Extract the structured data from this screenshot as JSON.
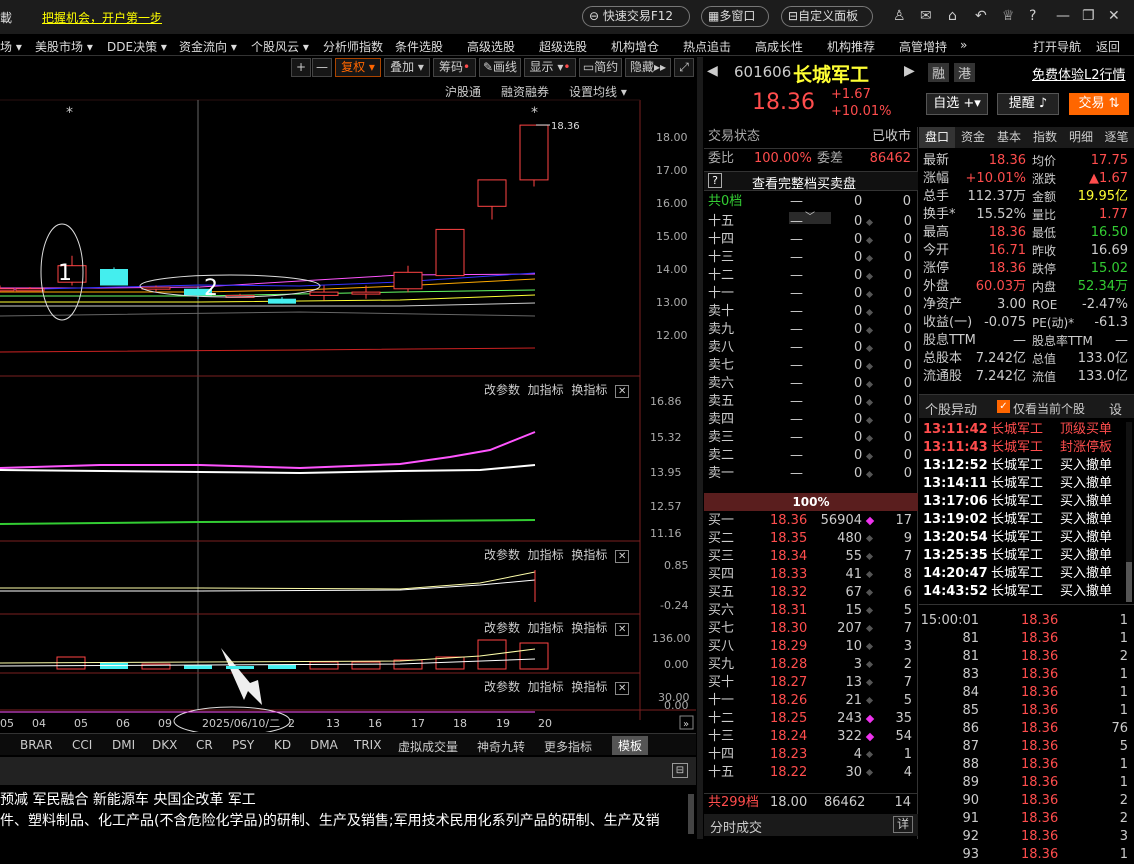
{
  "topbar": {
    "left_partial": "載",
    "slogan": "把握机会，开户第一步",
    "quick_trade": "快速交易F12",
    "multi_window": "多窗口",
    "custom_panel": "自定义面板"
  },
  "menu": [
    "场 ▾",
    "美股市场 ▾",
    "DDE决策 ▾",
    "资金流向 ▾",
    "个股风云 ▾",
    "分析师指数",
    "条件选股",
    "高级选股",
    "超级选股",
    "机构增仓",
    "热点追击",
    "高成长性",
    "机构推荐",
    "高管增持",
    "»",
    "打开导航",
    "返回"
  ],
  "toolbar": {
    "plus": "+",
    "minus": "—",
    "fuquan": "复权",
    "diejia": "叠加",
    "chouma": "筹码",
    "huaxian": "画线",
    "xianshi": "显示",
    "jianyue": "简约",
    "yincang": "隐藏"
  },
  "chart_header": {
    "hgt": "沪股通",
    "rzrq": "融资融券",
    "setma": "设置均线"
  },
  "main_chart": {
    "last_label": "18.36",
    "y_ticks": [
      "18.00",
      "17.00",
      "16.00",
      "15.00",
      "14.00",
      "13.00",
      "12.00"
    ],
    "marker1": "1",
    "marker2": "2",
    "star": "*"
  },
  "panel_ctrl": {
    "modify": "改参数",
    "add": "加指标",
    "change": "换指标",
    "close": "✕"
  },
  "ind1": {
    "ticks": [
      "16.86",
      "15.32",
      "13.95",
      "12.57",
      "11.16"
    ]
  },
  "ind2": {
    "ticks": [
      "0.85",
      "-0.24"
    ]
  },
  "ind3": {
    "ticks": [
      "136.00",
      "0.00"
    ]
  },
  "ind4": {
    "ticks": [
      "30.00",
      "0.00"
    ]
  },
  "xaxis": {
    "labels": [
      "05",
      "04",
      "05",
      "06",
      "09",
      "2025/06/10/二",
      "2",
      "13",
      "16",
      "17",
      "18",
      "19",
      "20"
    ]
  },
  "ind_tabs": [
    "BRAR",
    "CCI",
    "DMI",
    "DKX",
    "CR",
    "PSY",
    "KD",
    "DMA",
    "TRIX",
    "虚拟成交量",
    "神奇九转",
    "更多指标",
    "模板"
  ],
  "news": {
    "line1": "预减  军民融合  新能源车  央国企改革  军工",
    "line2": "件、塑料制品、化工产品(不含危险化学品)的研制、生产及销售;军用技术民用化系列产品的研制、生产及销"
  },
  "stock": {
    "code": "601606",
    "name": "长城军工",
    "price": "18.36",
    "change": "+1.67",
    "pct": "+10.01%",
    "btn_rong": "融",
    "btn_gang": "港",
    "l2": "免费体验L2行情",
    "zixuan": "自选",
    "tixing": "提醒",
    "jiaoyi": "交易"
  },
  "orderbook": {
    "status_label": "交易状态",
    "status": "已收市",
    "weibi_label": "委比",
    "weibi": "100.00%",
    "weicha_label": "委差",
    "weicha": "86462",
    "full": "查看完整档买卖盘",
    "gong0": "共0档",
    "dash": "—",
    "zero": "0",
    "sell": [
      "十五",
      "十四",
      "十三",
      "十二",
      "十一",
      "卖十",
      "卖九",
      "卖八",
      "卖七",
      "卖六",
      "卖五",
      "卖四",
      "卖三",
      "卖二",
      "卖一"
    ],
    "pct": "100%",
    "buy": [
      [
        "买一",
        "18.36",
        "56904",
        "17"
      ],
      [
        "买二",
        "18.35",
        "480",
        "9"
      ],
      [
        "买三",
        "18.34",
        "55",
        "7"
      ],
      [
        "买四",
        "18.33",
        "41",
        "8"
      ],
      [
        "买五",
        "18.32",
        "67",
        "6"
      ],
      [
        "买六",
        "18.31",
        "15",
        "5"
      ],
      [
        "买七",
        "18.30",
        "207",
        "7"
      ],
      [
        "买八",
        "18.29",
        "10",
        "3"
      ],
      [
        "买九",
        "18.28",
        "3",
        "2"
      ],
      [
        "买十",
        "18.27",
        "13",
        "7"
      ],
      [
        "十一",
        "18.26",
        "21",
        "5"
      ],
      [
        "十二",
        "18.25",
        "243",
        "35"
      ],
      [
        "十三",
        "18.24",
        "322",
        "54"
      ],
      [
        "十四",
        "18.23",
        "4",
        "1"
      ],
      [
        "十五",
        "18.22",
        "30",
        "4"
      ]
    ],
    "gong299": "共299档",
    "g_price": "18.00",
    "g_vol": "86462",
    "g_cnt": "14",
    "fenshi": "分时成交",
    "xiang": "详"
  },
  "tabs": [
    "盘口",
    "资金",
    "基本",
    "指数",
    "明细",
    "逐笔"
  ],
  "quote": [
    [
      "最新",
      "18.36",
      "均价",
      "17.75"
    ],
    [
      "涨幅",
      "+10.01%",
      "涨跌",
      "▲1.67"
    ],
    [
      "总手",
      "112.37万",
      "金额",
      "19.95亿"
    ],
    [
      "换手*",
      "15.52%",
      "量比",
      "1.77"
    ],
    [
      "最高",
      "18.36",
      "最低",
      "16.50"
    ],
    [
      "今开",
      "16.71",
      "昨收",
      "16.69"
    ],
    [
      "涨停",
      "18.36",
      "跌停",
      "15.02"
    ],
    [
      "外盘",
      "60.03万",
      "内盘",
      "52.34万"
    ],
    [
      "净资产",
      "3.00",
      "ROE",
      "-2.47%"
    ],
    [
      "收益(一)",
      "-0.075",
      "PE(动)*",
      "-61.3"
    ],
    [
      "股息TTM",
      "—",
      "股息率TTM",
      "—"
    ],
    [
      "总股本",
      "7.242亿",
      "总值",
      "133.0亿"
    ],
    [
      "流通股",
      "7.242亿",
      "流值",
      "133.0亿"
    ]
  ],
  "anomaly": {
    "title": "个股异动",
    "check": "仅看当前个股",
    "set": "设",
    "rows": [
      [
        "13:11:42",
        "长城军工",
        "顶级买单"
      ],
      [
        "13:11:43",
        "长城军工",
        "封涨停板"
      ],
      [
        "13:12:52",
        "长城军工",
        "买入撤单"
      ],
      [
        "13:14:11",
        "长城军工",
        "买入撤单"
      ],
      [
        "13:17:06",
        "长城军工",
        "买入撤单"
      ],
      [
        "13:19:02",
        "长城军工",
        "买入撤单"
      ],
      [
        "13:20:54",
        "长城军工",
        "买入撤单"
      ],
      [
        "13:25:35",
        "长城军工",
        "买入撤单"
      ],
      [
        "14:20:47",
        "长城军工",
        "买入撤单"
      ],
      [
        "14:43:52",
        "长城军工",
        "买入撤单"
      ]
    ]
  },
  "ticks": [
    [
      "15:00:01",
      "18.36",
      "1"
    ],
    [
      "81",
      "18.36",
      "1"
    ],
    [
      "81",
      "18.36",
      "2"
    ],
    [
      "83",
      "18.36",
      "1"
    ],
    [
      "84",
      "18.36",
      "1"
    ],
    [
      "85",
      "18.36",
      "1"
    ],
    [
      "86",
      "18.36",
      "76"
    ],
    [
      "87",
      "18.36",
      "5"
    ],
    [
      "88",
      "18.36",
      "1"
    ],
    [
      "89",
      "18.36",
      "1"
    ],
    [
      "90",
      "18.36",
      "2"
    ],
    [
      "91",
      "18.36",
      "2"
    ],
    [
      "92",
      "18.36",
      "3"
    ],
    [
      "93",
      "18.36",
      "1"
    ]
  ],
  "chart_data": {
    "type": "candlestick",
    "y_range": [
      11.5,
      18.6
    ],
    "last": 18.36,
    "candles": [
      {
        "o": 13.4,
        "h": 13.5,
        "l": 13.3,
        "c": 13.4,
        "up": true
      },
      {
        "o": 13.4,
        "h": 13.45,
        "l": 13.35,
        "c": 13.4,
        "up": true
      },
      {
        "o": 13.6,
        "h": 14.4,
        "l": 13.5,
        "c": 14.1,
        "up": true
      },
      {
        "o": 14.0,
        "h": 14.05,
        "l": 13.5,
        "c": 13.5,
        "up": false
      },
      {
        "o": 13.45,
        "h": 13.5,
        "l": 13.3,
        "c": 13.4,
        "up": true
      },
      {
        "o": 13.4,
        "h": 13.45,
        "l": 13.1,
        "c": 13.2,
        "up": false
      },
      {
        "o": 13.2,
        "h": 13.25,
        "l": 13.15,
        "c": 13.2,
        "up": true
      },
      {
        "o": 13.1,
        "h": 13.15,
        "l": 12.95,
        "c": 12.95,
        "up": false
      },
      {
        "o": 13.2,
        "h": 13.5,
        "l": 13.05,
        "c": 13.3,
        "up": true
      },
      {
        "o": 13.3,
        "h": 13.5,
        "l": 13.1,
        "c": 13.3,
        "up": true
      },
      {
        "o": 13.4,
        "h": 14.1,
        "l": 13.3,
        "c": 13.9,
        "up": true
      },
      {
        "o": 13.8,
        "h": 15.2,
        "l": 13.8,
        "c": 15.2,
        "up": true
      },
      {
        "o": 15.9,
        "h": 16.7,
        "l": 15.5,
        "c": 16.7,
        "up": true
      },
      {
        "o": 16.7,
        "h": 18.36,
        "l": 16.5,
        "c": 18.36,
        "up": true
      }
    ]
  }
}
